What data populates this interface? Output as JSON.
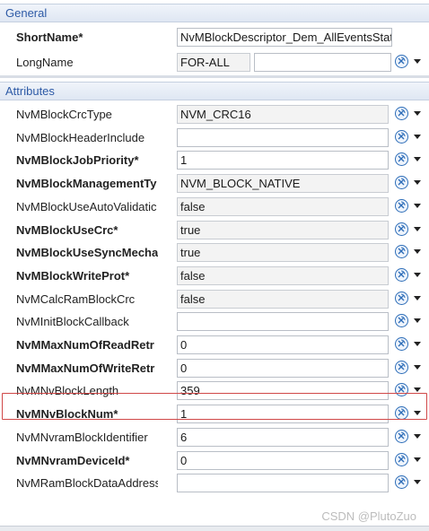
{
  "sections": {
    "general": "General",
    "attributes": "Attributes"
  },
  "general": {
    "short_name_label": "ShortName*",
    "short_name_value": "NvMBlockDescriptor_Dem_AllEventsStat",
    "long_name_label": "LongName",
    "long_name_lang": "FOR-ALL",
    "long_name_value": ""
  },
  "attributes": [
    {
      "label": "NvMBlockCrcType",
      "bold": false,
      "value": "NVM_CRC16",
      "readonly": true
    },
    {
      "label": "NvMBlockHeaderInclude",
      "bold": false,
      "value": "",
      "readonly": false
    },
    {
      "label": "NvMBlockJobPriority*",
      "bold": true,
      "value": "1",
      "readonly": false
    },
    {
      "label": "NvMBlockManagementTy",
      "bold": true,
      "value": "NVM_BLOCK_NATIVE",
      "readonly": true
    },
    {
      "label": "NvMBlockUseAutoValidatic",
      "bold": false,
      "value": "false",
      "readonly": true
    },
    {
      "label": "NvMBlockUseCrc*",
      "bold": true,
      "value": "true",
      "readonly": true
    },
    {
      "label": "NvMBlockUseSyncMechar",
      "bold": true,
      "value": "true",
      "readonly": true
    },
    {
      "label": "NvMBlockWriteProt*",
      "bold": true,
      "value": "false",
      "readonly": true
    },
    {
      "label": "NvMCalcRamBlockCrc",
      "bold": false,
      "value": "false",
      "readonly": true
    },
    {
      "label": "NvMInitBlockCallback",
      "bold": false,
      "value": "",
      "readonly": false
    },
    {
      "label": "NvMMaxNumOfReadRetr",
      "bold": true,
      "value": "0",
      "readonly": false
    },
    {
      "label": "NvMMaxNumOfWriteRetr",
      "bold": true,
      "value": "0",
      "readonly": false
    },
    {
      "label": "NvMNvBlockLength",
      "bold": false,
      "value": "359",
      "readonly": false
    },
    {
      "label": "NvMNvBlockNum*",
      "bold": true,
      "value": "1",
      "readonly": false
    },
    {
      "label": "NvMNvramBlockIdentifier",
      "bold": false,
      "value": "6",
      "readonly": false
    },
    {
      "label": "NvMNvramDeviceId*",
      "bold": true,
      "value": "0",
      "readonly": false
    },
    {
      "label": "NvMRamBlockDataAddress",
      "bold": false,
      "value": "",
      "readonly": false
    }
  ],
  "highlight_color": "#d04848",
  "accent_color": "#2d5aa6",
  "watermark": "CSDN @PlutoZuo",
  "icons": {
    "reset": "reset-default-icon",
    "dropdown": "chevron-down-icon"
  }
}
